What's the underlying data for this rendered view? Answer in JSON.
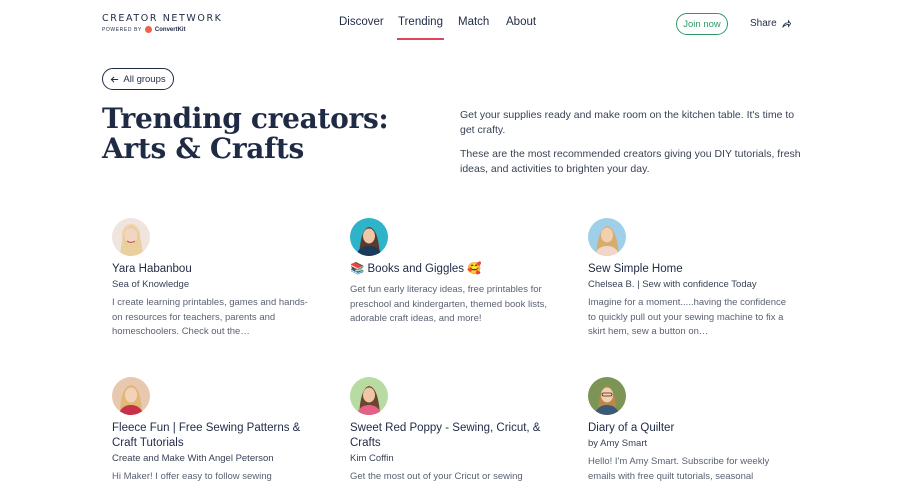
{
  "brand": {
    "title": "CREATOR NETWORK",
    "powered_by": "POWERED BY",
    "convertkit": "ConvertKit"
  },
  "nav": {
    "items": [
      {
        "label": "Discover"
      },
      {
        "label": "Trending"
      },
      {
        "label": "Match"
      },
      {
        "label": "About"
      }
    ],
    "active": "Trending"
  },
  "actions": {
    "join_label": "Join now",
    "share_label": "Share"
  },
  "back": {
    "label": "All groups"
  },
  "page": {
    "title": "Trending creators: Arts & Crafts",
    "intro_1": "Get your supplies ready and make room on the kitchen table. It's time to get crafty.",
    "intro_2": "These are the most recommended creators giving you DIY tutorials, fresh ideas, and activities to brighten your day."
  },
  "creators": [
    {
      "name": "Yara Habanbou",
      "subtitle": "Sea of Knowledge",
      "description": "I create learning printables, games and hands-on resources for teachers, parents and homeschoolers. Check out the…",
      "avatar_color": "#e9c9b8"
    },
    {
      "name": "📚 Books and Giggles 🥰",
      "subtitle": "",
      "description": "Get fun early literacy ideas, free printables for preschool and kindergarten, themed book lists, adorable craft ideas, and more!",
      "avatar_color": "#2fb3c9"
    },
    {
      "name": "Sew Simple Home",
      "subtitle": "Chelsea B. | Sew with confidence Today",
      "description": "Imagine for a moment.....having the confidence to quickly pull out your sewing machine to fix a skirt hem, sew a button on…",
      "avatar_color": "#8fc4e0"
    },
    {
      "name": "Fleece Fun | Free Sewing Patterns & Craft Tutorials",
      "subtitle": "Create and Make With Angel Peterson",
      "description": "Hi Maker! I offer easy to follow sewing",
      "avatar_color": "#c98a6a"
    },
    {
      "name": "Sweet Red Poppy - Sewing, Cricut, & Crafts",
      "subtitle": "Kim Coffin",
      "description": "Get the most out of your Cricut or sewing",
      "avatar_color": "#9ccf7a"
    },
    {
      "name": "Diary of a Quilter",
      "subtitle": "by Amy Smart",
      "description": "Hello! I'm Amy Smart. Subscribe for weekly emails with free quilt tutorials, seasonal",
      "avatar_color": "#6f8a4a"
    }
  ],
  "colors": {
    "navy": "#1f2a44",
    "accent_red": "#e0445a",
    "join_green": "#2e9a6a"
  }
}
